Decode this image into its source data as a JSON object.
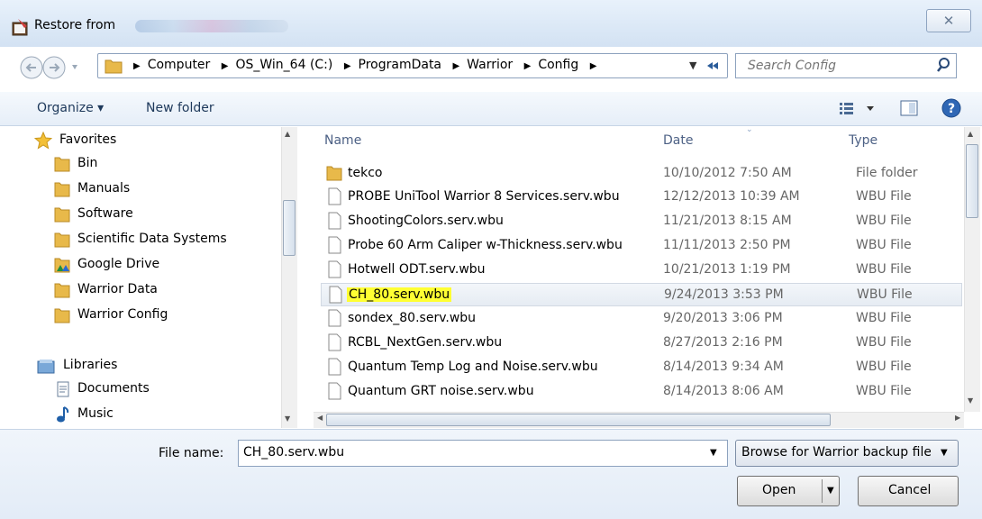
{
  "window": {
    "title": "Restore from",
    "close_glyph": "✕"
  },
  "address": {
    "crumbs": [
      "Computer",
      "OS_Win_64 (C:)",
      "ProgramData",
      "Warrior",
      "Config"
    ],
    "search_placeholder": "Search Config"
  },
  "toolbar": {
    "organize_label": "Organize ▾",
    "new_folder_label": "New folder"
  },
  "nav": {
    "favorites_label": "Favorites",
    "favorites": [
      "Bin",
      "Manuals",
      "Software",
      "Scientific Data Systems",
      "Google Drive",
      "Warrior Data",
      "Warrior Config"
    ],
    "libraries_label": "Libraries",
    "libraries": [
      "Documents",
      "Music"
    ]
  },
  "columns": {
    "name": "Name",
    "date": "Date",
    "type": "Type"
  },
  "files": [
    {
      "name": "tekco",
      "date": "10/10/2012 7:50 AM",
      "type": "File folder",
      "icon": "folder-icon"
    },
    {
      "name": "PROBE UniTool Warrior 8 Services.serv.wbu",
      "date": "12/12/2013 10:39 AM",
      "type": "WBU File",
      "icon": "file-icon"
    },
    {
      "name": "ShootingColors.serv.wbu",
      "date": "11/21/2013 8:15 AM",
      "type": "WBU File",
      "icon": "file-icon"
    },
    {
      "name": "Probe 60 Arm Caliper w-Thickness.serv.wbu",
      "date": "11/11/2013 2:50 PM",
      "type": "WBU File",
      "icon": "file-icon"
    },
    {
      "name": "Hotwell ODT.serv.wbu",
      "date": "10/21/2013 1:19 PM",
      "type": "WBU File",
      "icon": "file-icon"
    },
    {
      "name": "CH_80.serv.wbu",
      "date": "9/24/2013 3:53 PM",
      "type": "WBU File",
      "icon": "file-icon",
      "selected": true
    },
    {
      "name": "sondex_80.serv.wbu",
      "date": "9/20/2013 3:06 PM",
      "type": "WBU File",
      "icon": "file-icon"
    },
    {
      "name": "RCBL_NextGen.serv.wbu",
      "date": "8/27/2013 2:16 PM",
      "type": "WBU File",
      "icon": "file-icon"
    },
    {
      "name": "Quantum Temp Log and Noise.serv.wbu",
      "date": "8/14/2013 9:34 AM",
      "type": "WBU File",
      "icon": "file-icon"
    },
    {
      "name": "Quantum GRT noise.serv.wbu",
      "date": "8/14/2013 8:06 AM",
      "type": "WBU File",
      "icon": "file-icon"
    }
  ],
  "footer": {
    "file_name_label": "File name:",
    "file_name_value": "CH_80.serv.wbu",
    "filter_label": "Browse for Warrior backup file (",
    "open_label": "Open",
    "cancel_label": "Cancel"
  },
  "colors": {
    "highlight": "#ffff33",
    "folder": "#e8b94a",
    "chrome": "#dbe8f6"
  }
}
